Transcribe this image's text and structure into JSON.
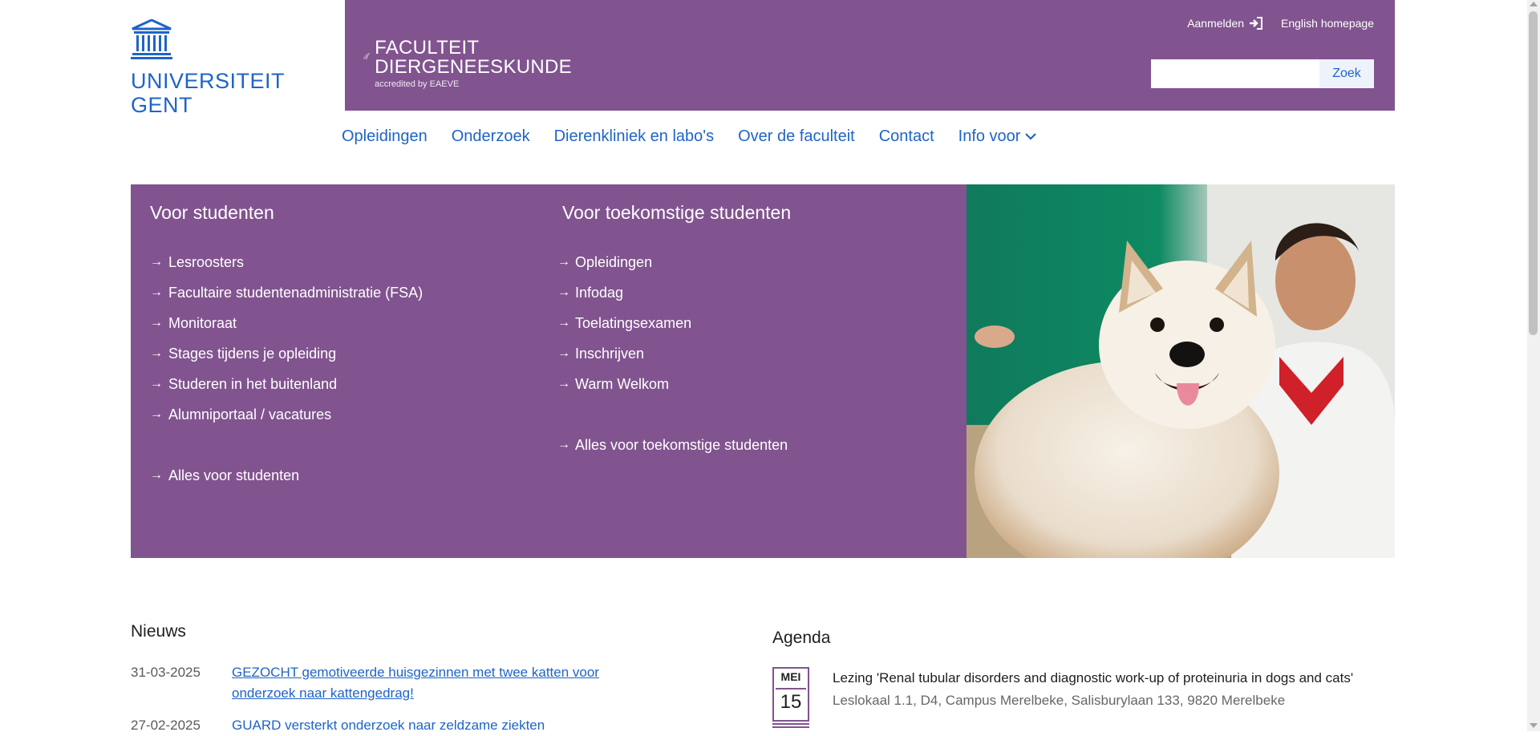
{
  "logo": {
    "line1": "UNIVERSITEIT",
    "line2": "GENT"
  },
  "faculty": {
    "line1": "FACULTEIT",
    "line2": "DIERGENEESKUNDE",
    "sub": "accredited by EAEVE"
  },
  "top_links": {
    "login": "Aanmelden",
    "english": "English homepage"
  },
  "search": {
    "placeholder": "",
    "button": "Zoek"
  },
  "nav": {
    "items": [
      "Opleidingen",
      "Onderzoek",
      "Dierenkliniek en labo's",
      "Over de faculteit",
      "Contact"
    ],
    "info": "Info voor"
  },
  "panel": {
    "students": {
      "title": "Voor studenten",
      "links": [
        "Lesroosters",
        "Facultaire studentenadministratie (FSA)",
        "Monitoraat",
        "Stages tijdens je opleiding",
        "Studeren in het buitenland",
        "Alumniportaal / vacatures"
      ],
      "all": "Alles voor studenten"
    },
    "future": {
      "title": "Voor toekomstige studenten",
      "links": [
        "Opleidingen",
        "Infodag",
        "Toelatingsexamen",
        "Inschrijven",
        "Warm Welkom"
      ],
      "all": "Alles voor toekomstige studenten"
    }
  },
  "news": {
    "title": "Nieuws",
    "items": [
      {
        "date": "31-03-2025",
        "text": "GEZOCHT gemotiveerde huisgezinnen met twee katten voor onderzoek naar kattengedrag!"
      },
      {
        "date": "27-02-2025",
        "text": "GUARD versterkt onderzoek naar zeldzame ziekten"
      }
    ]
  },
  "agenda": {
    "title": "Agenda",
    "month": "MEI",
    "day": "15",
    "event_title": "Lezing 'Renal tubular disorders and diagnostic work-up of proteinuria in dogs and cats'",
    "event_location": "Leslokaal 1.1, D4, Campus Merelbeke, Salisburylaan 133, 9820 Merelbeke"
  },
  "colors": {
    "purple": "#81548f",
    "ugent_blue": "#1e64c8"
  }
}
